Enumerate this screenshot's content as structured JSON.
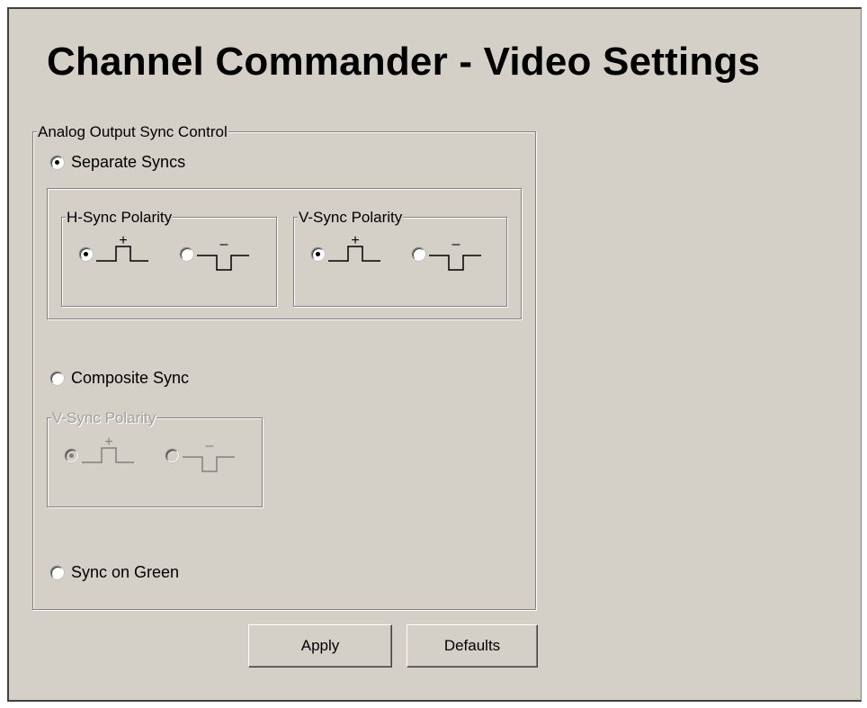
{
  "window": {
    "title": "Channel Commander - Video Settings"
  },
  "analog_group": {
    "label": "Analog Output Sync Control",
    "separate_syncs": {
      "label": "Separate Syncs",
      "selected": true
    },
    "h_sync": {
      "label": "H-Sync Polarity",
      "positive_sign": "+",
      "negative_sign": "–",
      "selected": "positive"
    },
    "v_sync": {
      "label": "V-Sync Polarity",
      "positive_sign": "+",
      "negative_sign": "–",
      "selected": "positive"
    },
    "composite_sync": {
      "label": "Composite Sync",
      "selected": false
    },
    "composite_v_sync": {
      "label": "V-Sync Polarity",
      "positive_sign": "+",
      "negative_sign": "–",
      "selected": "positive",
      "enabled": false
    },
    "sync_on_green": {
      "label": "Sync on Green",
      "selected": false
    }
  },
  "buttons": {
    "apply": "Apply",
    "defaults": "Defaults"
  },
  "colors": {
    "face": "#d4d0c8",
    "shadow": "#808080",
    "disabled_text": "#a0a0a0"
  }
}
